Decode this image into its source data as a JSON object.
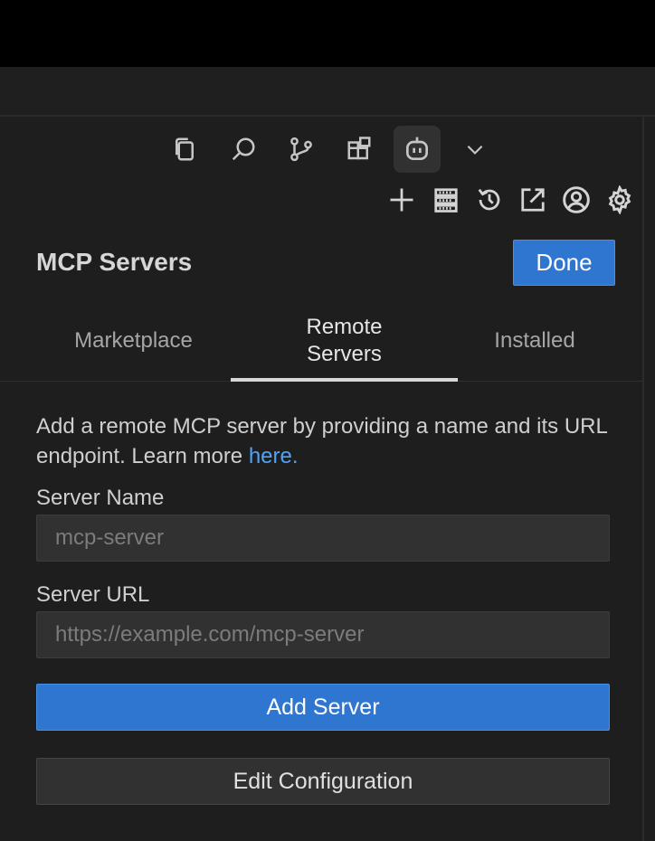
{
  "activity_bar": {
    "items": [
      {
        "icon": "copy-icon"
      },
      {
        "icon": "search-icon"
      },
      {
        "icon": "source-control-icon"
      },
      {
        "icon": "extensions-icon"
      },
      {
        "icon": "robot-icon",
        "active": true
      },
      {
        "icon": "chevron-down-icon"
      }
    ]
  },
  "toolbar": {
    "icons": [
      "plus-icon",
      "server-stack-icon",
      "history-icon",
      "open-external-icon",
      "account-icon",
      "gear-icon"
    ]
  },
  "header": {
    "title": "MCP Servers",
    "done_label": "Done"
  },
  "tabs": [
    {
      "label": "Marketplace",
      "active": false
    },
    {
      "label": "Remote Servers",
      "line1": "Remote",
      "line2": "Servers",
      "active": true
    },
    {
      "label": "Installed",
      "active": false
    }
  ],
  "form": {
    "description": "Add a remote MCP server by providing a name and its URL endpoint. Learn more ",
    "learn_more_link": "here.",
    "server_name_label": "Server Name",
    "server_name_placeholder": "mcp-server",
    "server_name_value": "",
    "server_url_label": "Server URL",
    "server_url_placeholder": "https://example.com/mcp-server",
    "server_url_value": "",
    "add_button": "Add Server",
    "edit_button": "Edit Configuration"
  },
  "colors": {
    "accent": "#2f76d1",
    "link": "#4fa3f7",
    "background": "#1e1e1e"
  }
}
